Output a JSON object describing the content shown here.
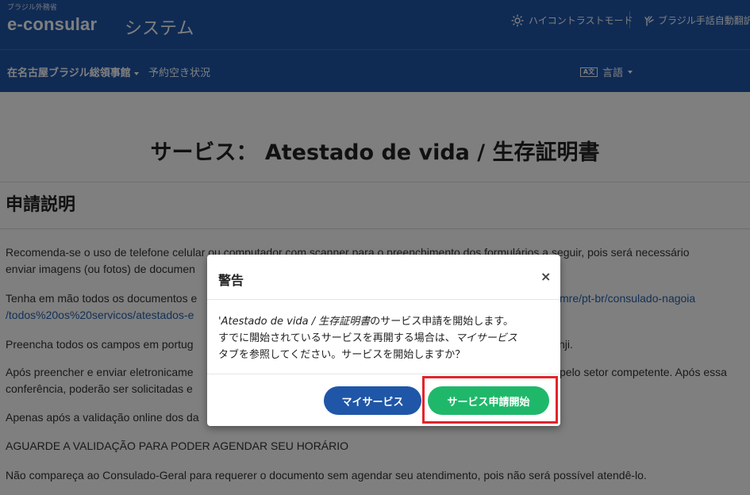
{
  "header": {
    "brand_small": "ブラジル外務省",
    "brand_main": "e-consular",
    "brand_sub": "システム",
    "high_contrast": "ハイコントラストモード",
    "handtalk": "ブラジル手話自動翻訳ア"
  },
  "nav": {
    "consulate": "在名古屋ブラジル総領事館",
    "availability": "予約空き状況",
    "language_icon": "A文",
    "language": "言語"
  },
  "page": {
    "title": "サービス： Atestado de vida / 生存証明書",
    "section_title": "申請説明",
    "paragraphs": {
      "p1a": "Recomenda-se o uso de telefone celular ou computador com scanner para o preenchimento dos formulários a seguir, pois será necessário",
      "p1b": "enviar imagens (ou fotos) de documen",
      "p2a": "Tenha em mão todos os documentos e",
      "p2_link_a": "mre/pt-br/consulado-nagoia",
      "p2_link_b": "/todos%20os%20servicos/atestados-e",
      "p3": "Preencha todos os campos em portug",
      "p3_tail": "nji.",
      "p4a": "Após preencher e enviar eletronicame",
      "p4a_tail": "pelo setor competente. Após essa",
      "p4b": "conferência, poderão ser solicitadas e",
      "p5": "Apenas após a validação online dos da",
      "p6": "AGUARDE A VALIDAÇÃO PARA PODER AGENDAR SEU HORÁRIO",
      "p7": "Não compareça ao Consulado-Geral para requerer o documento sem agendar seu atendimento, pois não será possível atendê-lo."
    }
  },
  "modal": {
    "title": "警告",
    "close": "×",
    "body_quote": "'",
    "body_service": "Atestado de vida / 生存証明書",
    "body_line1_rest": "のサービス申請を開始します。",
    "body_line2_a": "すでに開始されているサービスを再開する場合は、",
    "body_line2_link": "マイサービス",
    "body_line3": "タブを参照してください。サービスを開始しますか？",
    "btn_my_services": "マイサービス",
    "btn_start": "サービス申請開始"
  },
  "colors": {
    "header_blue": "#1f56a8",
    "start_green": "#1fb86a",
    "highlight_red": "#e3232b"
  }
}
